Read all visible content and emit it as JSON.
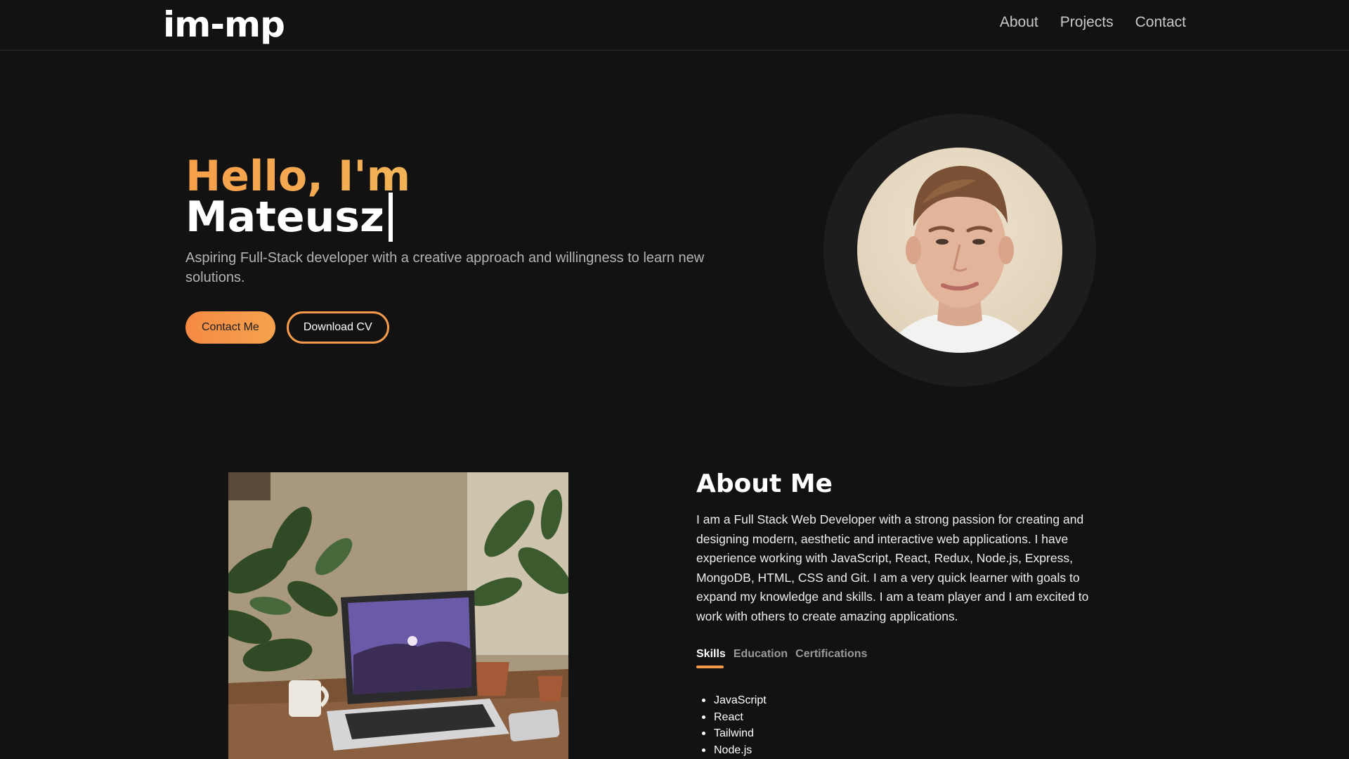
{
  "header": {
    "logo": "im-mp",
    "nav": [
      {
        "label": "About"
      },
      {
        "label": "Projects"
      },
      {
        "label": "Contact"
      }
    ]
  },
  "hero": {
    "greeting": "Hello, I'm",
    "name": "Mateusz",
    "description": "Aspiring Full-Stack developer with a creative approach and willingness to learn new solutions.",
    "buttons": {
      "contact_label": "Contact Me",
      "download_label": "Download CV"
    },
    "accent_color": "#f59a4a"
  },
  "about": {
    "title": "About Me",
    "text": "I am a Full Stack Web Developer with a strong passion for creating and designing modern, aesthetic and interactive web applications. I have experience working with JavaScript, React, Redux, Node.js, Express, MongoDB, HTML, CSS and Git. I am a very quick learner with goals to expand my knowledge and skills. I am a team player and I am excited to work with others to create amazing applications.",
    "tabs": [
      {
        "label": "Skills",
        "active": true
      },
      {
        "label": "Education",
        "active": false
      },
      {
        "label": "Certifications",
        "active": false
      }
    ],
    "skills": [
      "JavaScript",
      "React",
      "Tailwind",
      "Node.js"
    ]
  }
}
